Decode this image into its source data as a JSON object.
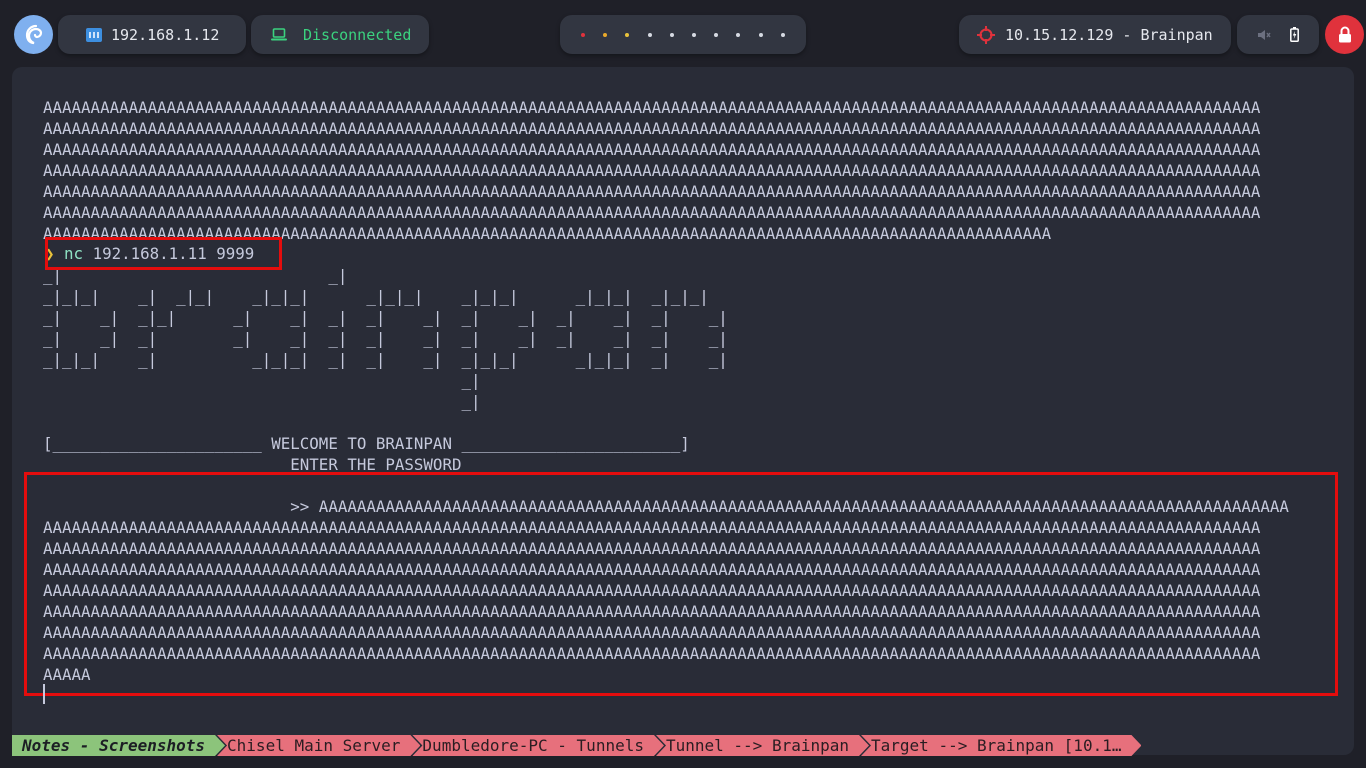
{
  "topbar": {
    "local_ip": "192.168.1.12",
    "vpn_status": "Disconnected",
    "target_label": "10.15.12.129 - Brainpan",
    "workspace_dot_colors": [
      "#e0323c",
      "#e9a92b",
      "#e9c33b",
      "#d6dae2",
      "#d6dae2",
      "#d6dae2",
      "#d6dae2",
      "#d6dae2",
      "#d6dae2",
      "#d6dae2"
    ],
    "icons": {
      "logo": "debian-swirl-icon",
      "local_ip": "network-icon",
      "vpn": "laptop-icon",
      "target": "crosshair-icon",
      "sound": "speaker-muted-icon",
      "battery": "battery-icon",
      "lock": "lock-icon"
    }
  },
  "terminal": {
    "prior_output": "AAAAAAAAAAAAAAAAAAAAAAAAAAAAAAAAAAAAAAAAAAAAAAAAAAAAAAAAAAAAAAAAAAAAAAAAAAAAAAAAAAAAAAAAAAAAAAAAAAAAAAAAAAAAAAAAAAAAAAAAAAAAAAAA\nAAAAAAAAAAAAAAAAAAAAAAAAAAAAAAAAAAAAAAAAAAAAAAAAAAAAAAAAAAAAAAAAAAAAAAAAAAAAAAAAAAAAAAAAAAAAAAAAAAAAAAAAAAAAAAAAAAAAAAAAAAAAAAAA\nAAAAAAAAAAAAAAAAAAAAAAAAAAAAAAAAAAAAAAAAAAAAAAAAAAAAAAAAAAAAAAAAAAAAAAAAAAAAAAAAAAAAAAAAAAAAAAAAAAAAAAAAAAAAAAAAAAAAAAAAAAAAAAAA\nAAAAAAAAAAAAAAAAAAAAAAAAAAAAAAAAAAAAAAAAAAAAAAAAAAAAAAAAAAAAAAAAAAAAAAAAAAAAAAAAAAAAAAAAAAAAAAAAAAAAAAAAAAAAAAAAAAAAAAAAAAAAAAAA\nAAAAAAAAAAAAAAAAAAAAAAAAAAAAAAAAAAAAAAAAAAAAAAAAAAAAAAAAAAAAAAAAAAAAAAAAAAAAAAAAAAAAAAAAAAAAAAAAAAAAAAAAAAAAAAAAAAAAAAAAAAAAAAAA\nAAAAAAAAAAAAAAAAAAAAAAAAAAAAAAAAAAAAAAAAAAAAAAAAAAAAAAAAAAAAAAAAAAAAAAAAAAAAAAAAAAAAAAAAAAAAAAAAAAAAAAAAAAAAAAAAAAAAAAAAAAAAAAAA\nAAAAAAAAAAAAAAAAAAAAAAAAAAAAAAAAAAAAAAAAAAAAAAAAAAAAAAAAAAAAAAAAAAAAAAAAAAAAAAAAAAAAAAAAAAAAAAAAAAAAAAAAAA",
    "prompt_symbol": "❯",
    "command_bin": "nc",
    "command_args": " 192.168.1.11 9999",
    "banner": "_|                            _|\n_|_|_|    _|  _|_|    _|_|_|      _|_|_|    _|_|_|      _|_|_|  _|_|_|\n_|    _|  _|_|      _|    _|  _|  _|    _|  _|    _|  _|    _|  _|    _|\n_|    _|  _|        _|    _|  _|  _|    _|  _|    _|  _|    _|  _|    _|\n_|_|_|    _|          _|_|_|  _|  _|    _|  _|_|_|      _|_|_|  _|    _|\n                                            _|\n                                            _|",
    "welcome": "[______________________ WELCOME TO BRAINPAN _______________________]",
    "enter_password": "                          ENTER THE PASSWORD",
    "password_prompt": "                          >> AAAAAAAAAAAAAAAAAAAAAAAAAAAAAAAAAAAAAAAAAAAAAAAAAAAAAAAAAAAAAAAAAAAAAAAAAAAAAAAAAAAAAAAAAAAAAAAAAAAAAA",
    "password_output": "AAAAAAAAAAAAAAAAAAAAAAAAAAAAAAAAAAAAAAAAAAAAAAAAAAAAAAAAAAAAAAAAAAAAAAAAAAAAAAAAAAAAAAAAAAAAAAAAAAAAAAAAAAAAAAAAAAAAAAAAAAAAAAAA\nAAAAAAAAAAAAAAAAAAAAAAAAAAAAAAAAAAAAAAAAAAAAAAAAAAAAAAAAAAAAAAAAAAAAAAAAAAAAAAAAAAAAAAAAAAAAAAAAAAAAAAAAAAAAAAAAAAAAAAAAAAAAAAAA\nAAAAAAAAAAAAAAAAAAAAAAAAAAAAAAAAAAAAAAAAAAAAAAAAAAAAAAAAAAAAAAAAAAAAAAAAAAAAAAAAAAAAAAAAAAAAAAAAAAAAAAAAAAAAAAAAAAAAAAAAAAAAAAAA\nAAAAAAAAAAAAAAAAAAAAAAAAAAAAAAAAAAAAAAAAAAAAAAAAAAAAAAAAAAAAAAAAAAAAAAAAAAAAAAAAAAAAAAAAAAAAAAAAAAAAAAAAAAAAAAAAAAAAAAAAAAAAAAAA\nAAAAAAAAAAAAAAAAAAAAAAAAAAAAAAAAAAAAAAAAAAAAAAAAAAAAAAAAAAAAAAAAAAAAAAAAAAAAAAAAAAAAAAAAAAAAAAAAAAAAAAAAAAAAAAAAAAAAAAAAAAAAAAAA\nAAAAAAAAAAAAAAAAAAAAAAAAAAAAAAAAAAAAAAAAAAAAAAAAAAAAAAAAAAAAAAAAAAAAAAAAAAAAAAAAAAAAAAAAAAAAAAAAAAAAAAAAAAAAAAAAAAAAAAAAAAAAAAAA\nAAAAAAAAAAAAAAAAAAAAAAAAAAAAAAAAAAAAAAAAAAAAAAAAAAAAAAAAAAAAAAAAAAAAAAAAAAAAAAAAAAAAAAAAAAAAAAAAAAAAAAAAAAAAAAAAAAAAAAAAAAAAAAAA\nAAAAA"
  },
  "tabs": [
    {
      "label": "Notes - Screenshots",
      "active": true
    },
    {
      "label": "Chisel Main Server",
      "active": false
    },
    {
      "label": "Dumbledore-PC - Tunnels",
      "active": false
    },
    {
      "label": "Tunnel --> Brainpan",
      "active": false
    },
    {
      "label": "Target --> Brainpan [10.1…",
      "active": false
    }
  ],
  "colors": {
    "highlight_box": "#e40d0d",
    "active_tab": "#8cc47b",
    "inactive_tab": "#e7707c",
    "vpn_status": "#3bd27f"
  }
}
